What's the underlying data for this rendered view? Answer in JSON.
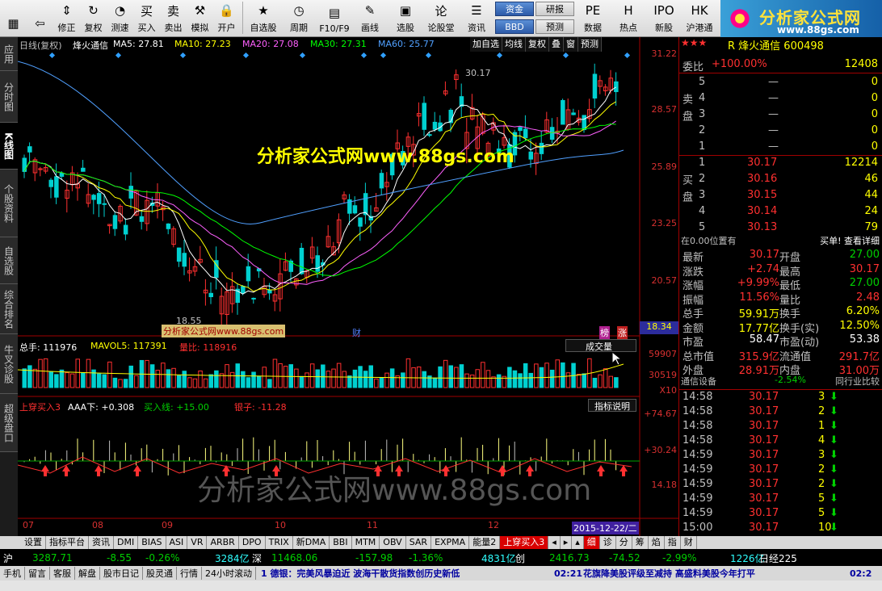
{
  "toolbar": {
    "buttons": [
      {
        "label": "",
        "icon": "grid-icon"
      },
      {
        "label": "",
        "icon": "back-arrow-icon"
      },
      {
        "label": "修正",
        "icon": "up-down-arrows-icon"
      },
      {
        "label": "复权",
        "icon": "refresh-icon"
      },
      {
        "label": "测速",
        "icon": "speedometer-icon"
      },
      {
        "label": "买入",
        "icon": "buy-icon"
      },
      {
        "label": "卖出",
        "icon": "sell-icon"
      },
      {
        "label": "模拟",
        "icon": "hammer-icon"
      },
      {
        "label": "开户",
        "icon": "lock-icon"
      },
      {
        "label": "自选股",
        "icon": "star-folder-icon"
      },
      {
        "label": "周期",
        "icon": "clock-icon"
      },
      {
        "label": "F10/F9",
        "icon": "f10-icon"
      },
      {
        "label": "画线",
        "icon": "pencil-icon"
      },
      {
        "label": "选股",
        "icon": "select-icon"
      },
      {
        "label": "论股堂",
        "icon": "forum-icon"
      },
      {
        "label": "资讯",
        "icon": "news-icon"
      },
      {
        "label": "数据",
        "icon": "pe-icon"
      },
      {
        "label": "热点",
        "icon": "hot-icon"
      },
      {
        "label": "新股",
        "icon": "ipo-icon"
      },
      {
        "label": "沪港通",
        "icon": "hk-icon"
      }
    ],
    "mini_buttons": [
      "资金",
      "BBD",
      "研报",
      "预测"
    ],
    "brand_title": "分析家公式网",
    "brand_url": "www.88gs.com"
  },
  "left_tabs": [
    "应用",
    "分时图",
    "K线图",
    "个股资料",
    "自选股",
    "综合排名",
    "牛叉诊股",
    "超级盘口"
  ],
  "chart": {
    "header": {
      "period": "日线(复权)",
      "stock": "烽火通信",
      "ma5": "MA5: 27.81",
      "ma10": "MA10: 27.23",
      "ma20": "MA20: 27.08",
      "ma30": "MA30: 27.31",
      "ma60": "MA60: 25.77",
      "buttons": [
        "加自选",
        "均线",
        "复权",
        "叠",
        "窗",
        "预测"
      ]
    },
    "price_axis": [
      "31.22",
      "28.57",
      "25.89",
      "23.25",
      "20.57"
    ],
    "current_price": "18.34",
    "high_label": "30.17",
    "low_label": "18.55",
    "watermark_small": "分析家公式网www.88gs.com",
    "watermark_big": "分析家公式网www.88gs.com",
    "watermark_big2": "分析家公式网www.88gs.com",
    "markers": [
      "财",
      "榜",
      "涨"
    ],
    "volume": {
      "total": "总手: 111976",
      "mavol5": "MAVOL5: 117391",
      "ratio": "量比: 118916",
      "button": "成交量",
      "axis": [
        "59907",
        "30519",
        "X10"
      ]
    },
    "indicator": {
      "name": "上穿买入3",
      "aaa": "AAA下: +0.308",
      "buyline": "买入线: +15.00",
      "zigzag": "银子: -11.28",
      "button": "指标说明",
      "axis": [
        "+74.67",
        "+30.24",
        "14.18"
      ]
    },
    "date_axis": [
      "07",
      "08",
      "09",
      "10",
      "11",
      "12"
    ],
    "date_cursor": "2015-12-22/二"
  },
  "right": {
    "title": "R 烽火通信 600498",
    "weibi_label": "委比",
    "weibi": "+100.00%",
    "weicha": "12408",
    "sell_label": "卖盘",
    "buy_label": "买盘",
    "sells": [
      {
        "n": "5",
        "p": "—",
        "v": "0"
      },
      {
        "n": "4",
        "p": "—",
        "v": "0"
      },
      {
        "n": "3",
        "p": "—",
        "v": "0"
      },
      {
        "n": "2",
        "p": "—",
        "v": "0"
      },
      {
        "n": "1",
        "p": "—",
        "v": "0"
      }
    ],
    "buys": [
      {
        "n": "1",
        "p": "30.17",
        "v": "12214"
      },
      {
        "n": "2",
        "p": "30.16",
        "v": "46"
      },
      {
        "n": "3",
        "p": "30.15",
        "v": "44"
      },
      {
        "n": "4",
        "p": "30.14",
        "v": "24"
      },
      {
        "n": "5",
        "p": "30.13",
        "v": "79"
      }
    ],
    "position_label": "在0.00位置有",
    "buy_detail": "买单! 查看详细",
    "stats": [
      {
        "l1": "最新",
        "v1": "30.17",
        "l2": "开盘",
        "v2": "27.00"
      },
      {
        "l1": "涨跌",
        "v1": "+2.74",
        "l2": "最高",
        "v2": "30.17"
      },
      {
        "l1": "涨幅",
        "v1": "+9.99%",
        "l2": "最低",
        "v2": "27.00"
      },
      {
        "l1": "振幅",
        "v1": "11.56%",
        "l2": "量比",
        "v2": "2.48"
      },
      {
        "l1": "总手",
        "v1": "59.91万",
        "l2": "换手",
        "v2": "6.20%"
      },
      {
        "l1": "金额",
        "v1": "17.77亿",
        "l2": "换手(实)",
        "v2": "12.50%"
      },
      {
        "l1": "市盈",
        "v1": "58.47",
        "l2": "市盈(动)",
        "v2": "53.38"
      },
      {
        "l1": "总市值",
        "v1": "315.9亿",
        "l2": "流通值",
        "v2": "291.7亿"
      },
      {
        "l1": "外盘",
        "v1": "28.91万",
        "l2": "内盘",
        "v2": "31.00万"
      }
    ],
    "sector": "通信设备",
    "sector_change": "-2.54%",
    "sector_button": "同行业比较",
    "trades": [
      {
        "t": "14:58",
        "p": "30.17",
        "v": "3"
      },
      {
        "t": "14:58",
        "p": "30.17",
        "v": "2"
      },
      {
        "t": "14:58",
        "p": "30.17",
        "v": "1"
      },
      {
        "t": "14:58",
        "p": "30.17",
        "v": "4"
      },
      {
        "t": "14:59",
        "p": "30.17",
        "v": "3"
      },
      {
        "t": "14:59",
        "p": "30.17",
        "v": "2"
      },
      {
        "t": "14:59",
        "p": "30.17",
        "v": "2"
      },
      {
        "t": "14:59",
        "p": "30.17",
        "v": "5"
      },
      {
        "t": "14:59",
        "p": "30.17",
        "v": "5"
      },
      {
        "t": "15:00",
        "p": "30.17",
        "v": "10"
      }
    ],
    "bottom_tabs": [
      "细",
      "诊",
      "分",
      "筹",
      "焰",
      "指",
      "财"
    ]
  },
  "bottom_tabs": [
    "设置",
    "指标平台",
    "资讯",
    "DMI",
    "BIAS",
    "ASI",
    "VR",
    "ARBR",
    "DPO",
    "TRIX",
    "新DMA",
    "BBI",
    "MTM",
    "OBV",
    "SAR",
    "EXPMA",
    "能量2",
    "上穿买入3"
  ],
  "index_bar": [
    {
      "text": "沪",
      "cls": "white"
    },
    {
      "text": "3287.71",
      "cls": "green"
    },
    {
      "text": "-8.55",
      "cls": "green"
    },
    {
      "text": "-0.26%",
      "cls": "green"
    },
    {
      "text": "3284亿",
      "cls": "cyan"
    },
    {
      "text": "深",
      "cls": "white"
    },
    {
      "text": "11468.06",
      "cls": "green"
    },
    {
      "text": "-157.98",
      "cls": "green"
    },
    {
      "text": "-1.36%",
      "cls": "green"
    },
    {
      "text": "4831亿",
      "cls": "cyan"
    },
    {
      "text": "创",
      "cls": "white"
    },
    {
      "text": "2416.73",
      "cls": "green"
    },
    {
      "text": "-74.52",
      "cls": "green"
    },
    {
      "text": "-2.99%",
      "cls": "green"
    },
    {
      "text": "1226亿",
      "cls": "cyan"
    },
    {
      "text": "日经225",
      "cls": "white"
    }
  ],
  "status_bar": {
    "items": [
      "手机",
      "留言",
      "客服",
      "解盘",
      "股市日记",
      "股灵通",
      "行情",
      "24小时滚动"
    ],
    "news1": "1 德银：完美风暴迫近 波海干散货指数创历史新低",
    "time": "02:21",
    "news2": "花旗降美股评级至减持 高盛料美股今年打平",
    "time2": "02:2"
  },
  "colors": {
    "up": "#ff3030",
    "down": "#00d0d0",
    "ma5": "#ffffff",
    "ma10": "#ffff00",
    "ma20": "#ff60ff",
    "ma30": "#00ff00",
    "ma60": "#50a0ff"
  }
}
